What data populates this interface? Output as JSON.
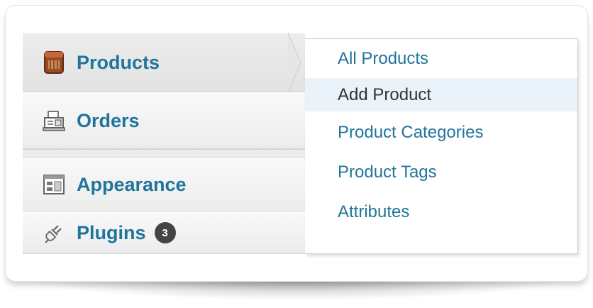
{
  "menu": {
    "items": [
      {
        "label": "Products",
        "icon": "products-box-icon"
      },
      {
        "label": "Orders",
        "icon": "cash-register-icon"
      },
      {
        "label": "Appearance",
        "icon": "appearance-layout-icon"
      },
      {
        "label": "Plugins",
        "icon": "plug-icon",
        "badge": "3"
      }
    ]
  },
  "submenu": {
    "items": [
      {
        "label": "All Products"
      },
      {
        "label": "Add Product"
      },
      {
        "label": "Product Categories"
      },
      {
        "label": "Product Tags"
      },
      {
        "label": "Attributes"
      }
    ]
  },
  "colors": {
    "link": "#21759b",
    "hover_text": "#333333",
    "hover_bg": "#eaf2fa",
    "badge_bg": "#444444"
  }
}
